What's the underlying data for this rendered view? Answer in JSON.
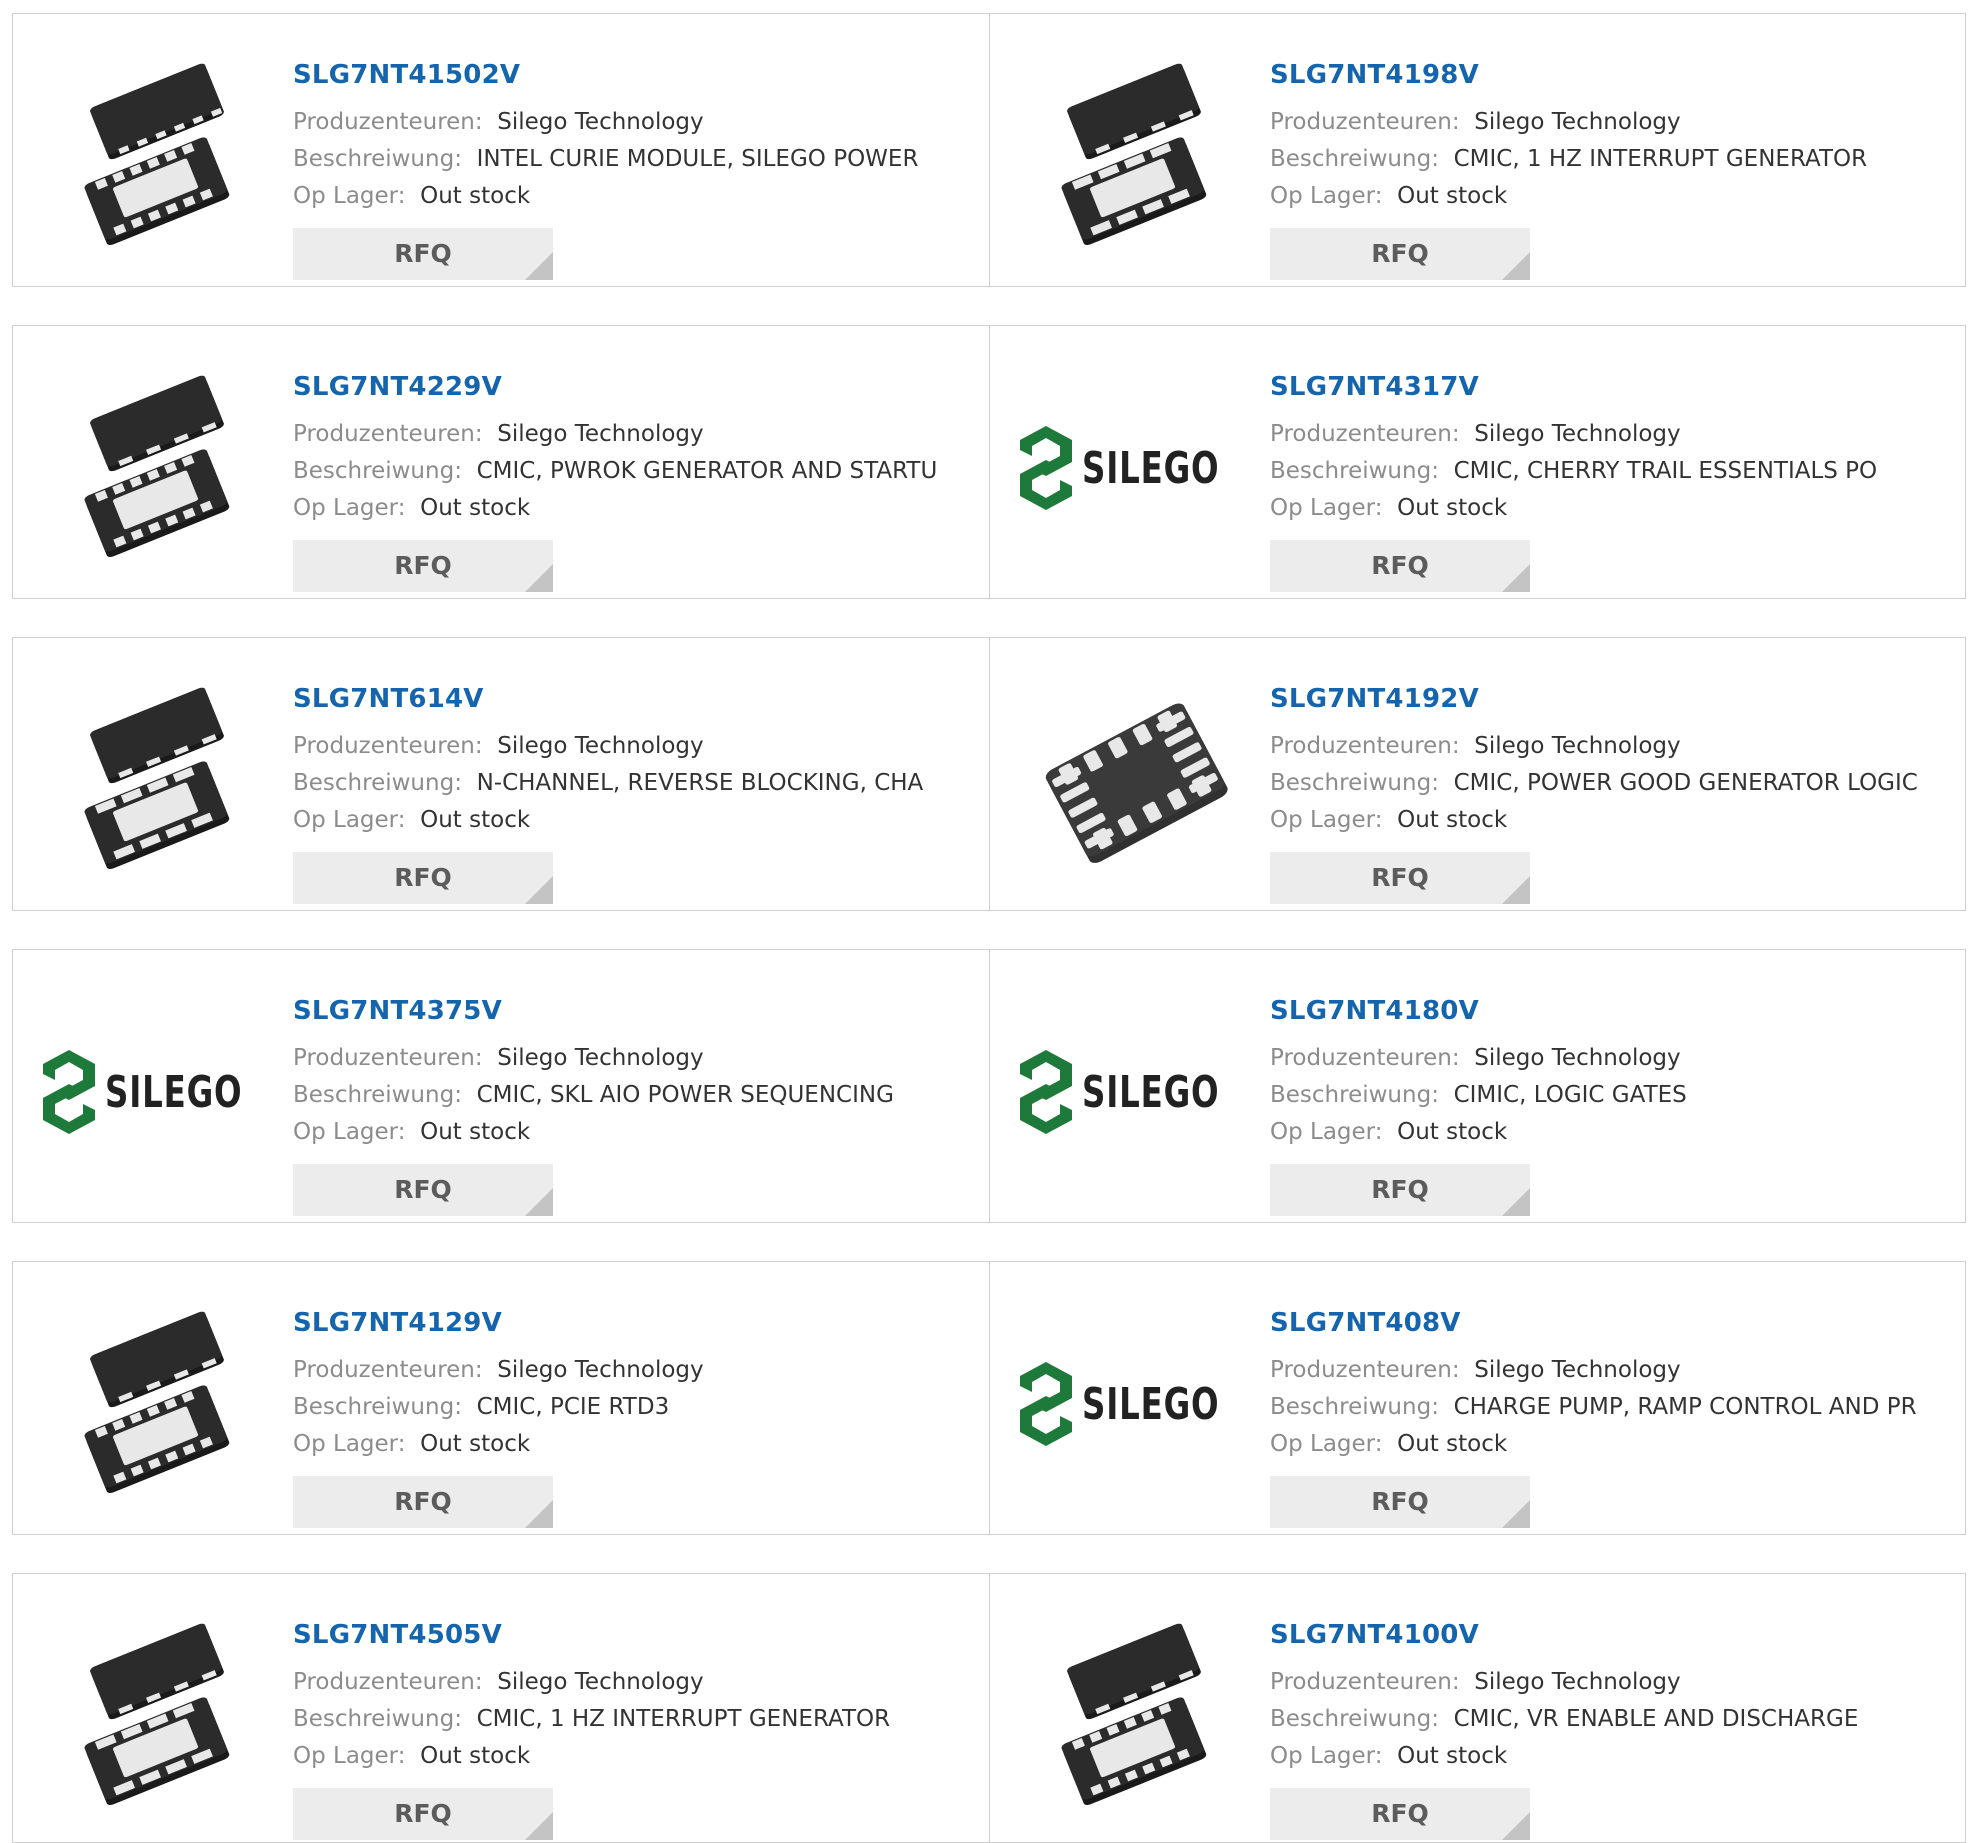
{
  "labels": {
    "manufacturer": "Produzenteuren:",
    "description": "Beschreiwung:",
    "stock": "Op Lager:"
  },
  "brand_logo_text": "SILEGO",
  "colors": {
    "link": "#1465ad",
    "label": "#8c8c8c",
    "value": "#333333",
    "button_bg": "#ececec",
    "button_text": "#5c5c5c",
    "logo_green": "#1e7a3a"
  },
  "products": [
    {
      "part": "SLG7NT41502V",
      "manufacturer": "Silego Technology",
      "description": "INTEL CURIE MODULE, SILEGO POWER",
      "stock": "Out stock",
      "image": "chip-qfn-icon",
      "button": "RFQ"
    },
    {
      "part": "SLG7NT4198V",
      "manufacturer": "Silego Technology",
      "description": "CMIC, 1 HZ INTERRUPT GENERATOR",
      "stock": "Out stock",
      "image": "chip-dfn-icon",
      "button": "RFQ"
    },
    {
      "part": "SLG7NT4229V",
      "manufacturer": "Silego Technology",
      "description": "CMIC, PWROK GENERATOR AND STARTU",
      "stock": "Out stock",
      "image": "chip-stqfn-icon",
      "button": "RFQ"
    },
    {
      "part": "SLG7NT4317V",
      "manufacturer": "Silego Technology",
      "description": "CMIC, CHERRY TRAIL ESSENTIALS PO",
      "stock": "Out stock",
      "image": "silego-logo",
      "button": "RFQ"
    },
    {
      "part": "SLG7NT614V",
      "manufacturer": "Silego Technology",
      "description": "N-CHANNEL, REVERSE BLOCKING, CHA",
      "stock": "Out stock",
      "image": "chip-dfn-icon",
      "button": "RFQ"
    },
    {
      "part": "SLG7NT4192V",
      "manufacturer": "Silego Technology",
      "description": "CMIC, POWER GOOD GENERATOR LOGIC",
      "stock": "Out stock",
      "image": "chip-qfn20-icon",
      "button": "RFQ"
    },
    {
      "part": "SLG7NT4375V",
      "manufacturer": "Silego Technology",
      "description": "CMIC, SKL AIO POWER SEQUENCING",
      "stock": "Out stock",
      "image": "silego-logo",
      "button": "RFQ"
    },
    {
      "part": "SLG7NT4180V",
      "manufacturer": "Silego Technology",
      "description": "CIMIC, LOGIC GATES",
      "stock": "Out stock",
      "image": "silego-logo",
      "button": "RFQ"
    },
    {
      "part": "SLG7NT4129V",
      "manufacturer": "Silego Technology",
      "description": "CMIC, PCIE RTD3",
      "stock": "Out stock",
      "image": "chip-stqfn-icon",
      "button": "RFQ"
    },
    {
      "part": "SLG7NT408V",
      "manufacturer": "Silego Technology",
      "description": "CHARGE PUMP, RAMP CONTROL AND PR",
      "stock": "Out stock",
      "image": "silego-logo",
      "button": "RFQ"
    },
    {
      "part": "SLG7NT4505V",
      "manufacturer": "Silego Technology",
      "description": "CMIC, 1 HZ INTERRUPT GENERATOR",
      "stock": "Out stock",
      "image": "chip-dfn-icon",
      "button": "RFQ"
    },
    {
      "part": "SLG7NT4100V",
      "manufacturer": "Silego Technology",
      "description": "CMIC, VR ENABLE AND DISCHARGE",
      "stock": "Out stock",
      "image": "chip-stqfn-icon",
      "button": "RFQ"
    }
  ]
}
